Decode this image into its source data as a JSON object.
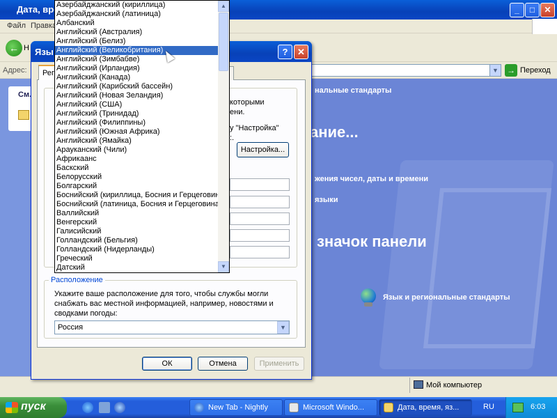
{
  "explorer": {
    "title": "Дата, вре",
    "menu": [
      "Файл",
      "Правка"
    ],
    "back_label": "Н",
    "address_label": "Адрес:",
    "go_label": "Переход",
    "left_panel_title": "См.",
    "status_computer": "Мой компьютер",
    "content": {
      "heading_small": "нальные стандарты",
      "heading_big": "ание...",
      "line_numbers": "жения чисел, даты и времени",
      "line_languages": "языки",
      "big_panel": "значок панели",
      "item_language": "Язык и региональные стандарты"
    }
  },
  "dialog": {
    "title": "Язы",
    "help_glyph": "?",
    "close_glyph": "✕",
    "tab_label": "Реги",
    "text_block1": "которыми\nени.",
    "text_block2": "у \"Настройка\"\n:.",
    "customize_button": "Настройка...",
    "location_group_label": "Расположение",
    "location_text": "Укажите ваше расположение для того, чтобы службы могли снабжать вас местной информацией, например, новостями и сводками погоды:",
    "location_value": "Россия",
    "ok_label": "ОК",
    "cancel_label": "Отмена",
    "apply_label": "Применить"
  },
  "dropdown": {
    "selected_index": 5,
    "items": [
      "Азербайджанский (кириллица)",
      "Азербайджанский (латиница)",
      "Албанский",
      "Английский (Австралия)",
      "Английский (Белиз)",
      "Английский (Великобритания)",
      "Английский (Зимбабве)",
      "Английский (Ирландия)",
      "Английский (Канада)",
      "Английский (Карибский бассейн)",
      "Английский (Новая Зеландия)",
      "Английский (США)",
      "Английский (Тринидад)",
      "Английский (Филиппины)",
      "Английский (Южная Африка)",
      "Английский (Ямайка)",
      "Арауканский (Чили)",
      "Африкаанс",
      "Баскский",
      "Белорусский",
      "Болгарский",
      "Боснийский (кириллица, Босния и Герцеговина)",
      "Боснийский (латиница, Босния и Герцеговина)",
      "Валлийский",
      "Венгерский",
      "Галисийский",
      "Голландский (Бельгия)",
      "Голландский (Нидерланды)",
      "Греческий",
      "Датский"
    ]
  },
  "taskbar": {
    "start_label": "пуск",
    "tasks": [
      {
        "label": "New Tab - Nightly",
        "icon": "globe-icon",
        "active": false
      },
      {
        "label": "Microsoft Windo...",
        "icon": "window-icon",
        "active": false
      },
      {
        "label": "Дата, время, яз...",
        "icon": "folder-icon",
        "active": true
      }
    ],
    "language": "RU",
    "clock": "6:03"
  }
}
